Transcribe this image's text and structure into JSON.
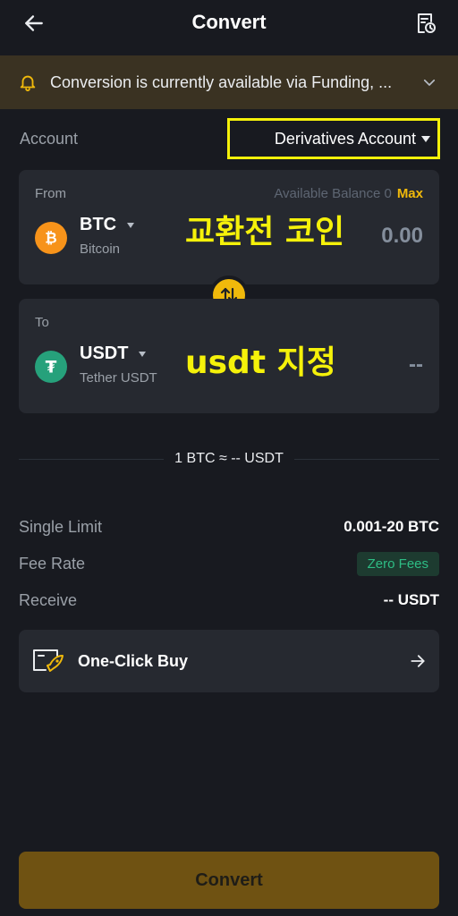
{
  "header": {
    "title": "Convert"
  },
  "notice": {
    "text": "Conversion is currently available via Funding, ..."
  },
  "account": {
    "label": "Account",
    "selected": "Derivatives Account"
  },
  "from": {
    "label": "From",
    "balance_label": "Available Balance 0",
    "max_label": "Max",
    "coin_symbol": "BTC",
    "coin_name": "Bitcoin",
    "amount": "0.00",
    "annotation": "교환전 코인"
  },
  "to": {
    "label": "To",
    "coin_symbol": "USDT",
    "coin_name": "Tether USDT",
    "amount": "--",
    "annotation": "usdt 지정"
  },
  "rate": {
    "text": "1 BTC ≈ -- USDT"
  },
  "info": {
    "single_limit_label": "Single Limit",
    "single_limit_value": "0.001-20 BTC",
    "fee_rate_label": "Fee Rate",
    "fee_rate_value": "Zero Fees",
    "receive_label": "Receive",
    "receive_value": "-- USDT"
  },
  "oneclick": {
    "label": "One-Click Buy"
  },
  "convert_button": {
    "label": "Convert"
  },
  "colors": {
    "accent": "#f0b90b",
    "background": "#181a20",
    "card": "#262930",
    "highlight": "#f5f10a",
    "positive": "#2ebd85"
  }
}
